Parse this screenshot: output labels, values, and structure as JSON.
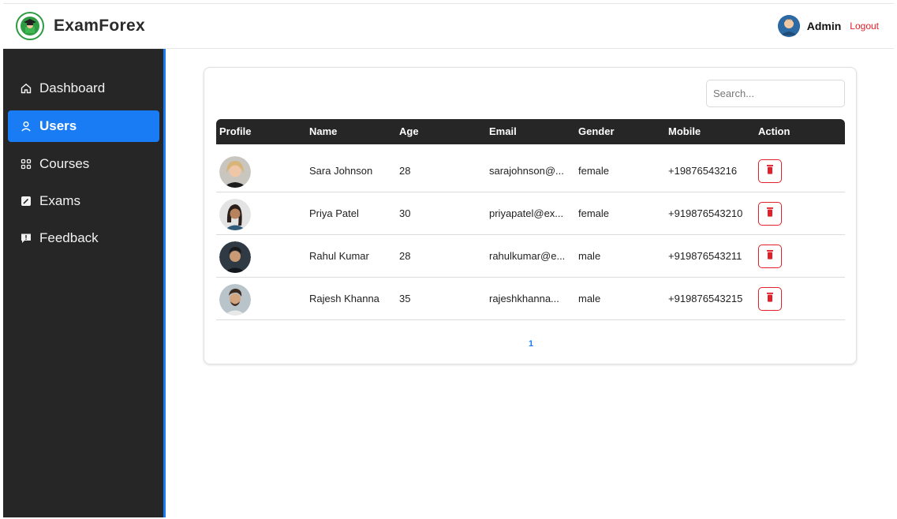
{
  "app": {
    "name": "ExamForex"
  },
  "header": {
    "user_name": "Admin",
    "logout_label": "Logout"
  },
  "sidebar": {
    "items": [
      {
        "label": "Dashboard",
        "icon": "home-icon",
        "active": false
      },
      {
        "label": "Users",
        "icon": "user-icon",
        "active": true
      },
      {
        "label": "Courses",
        "icon": "grid-icon",
        "active": false
      },
      {
        "label": "Exams",
        "icon": "exam-icon",
        "active": false
      },
      {
        "label": "Feedback",
        "icon": "feedback-icon",
        "active": false
      }
    ]
  },
  "search": {
    "placeholder": "Search...",
    "value": ""
  },
  "table": {
    "headers": [
      "Profile",
      "Name",
      "Age",
      "Email",
      "Gender",
      "Mobile",
      "Action"
    ],
    "rows": [
      {
        "name": "Sara Johnson",
        "age": "28",
        "email": "sarajohnson@...",
        "gender": "female",
        "mobile": "+19876543216"
      },
      {
        "name": "Priya Patel",
        "age": "30",
        "email": "priyapatel@ex...",
        "gender": "female",
        "mobile": "+919876543210"
      },
      {
        "name": "Rahul Kumar",
        "age": "28",
        "email": "rahulkumar@e...",
        "gender": "male",
        "mobile": "+919876543211"
      },
      {
        "name": "Rajesh Khanna",
        "age": "35",
        "email": "rajeshkhanna...",
        "gender": "male",
        "mobile": "+919876543215"
      }
    ]
  },
  "pagination": {
    "current": "1"
  },
  "colors": {
    "accent": "#1a7cf5",
    "sidebar_bg": "#262626",
    "danger": "#e0202a",
    "brand_green": "#2e9b43"
  }
}
